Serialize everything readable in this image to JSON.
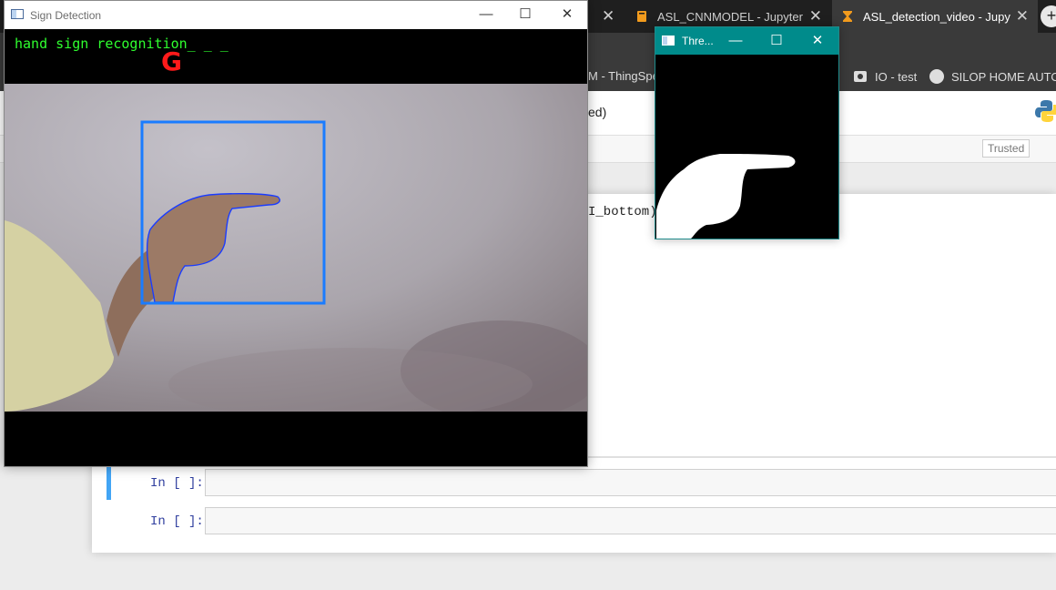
{
  "browser": {
    "tabs": [
      {
        "title": "ASL_CNNMODEL - Jupyter Not",
        "icon": "notebook-icon",
        "active": false
      },
      {
        "title": "ASL_detection_video - Jupyter",
        "icon": "hourglass-icon",
        "active": true
      }
    ],
    "tab_close_glyph": "✕",
    "newtab_glyph": "+",
    "bookmarks": [
      {
        "label": "M - ThingSpeak"
      },
      {
        "label": "IO - test"
      },
      {
        "label": "SILOP HOME AUTO..."
      }
    ]
  },
  "notebook": {
    "kernel_status": "ed)",
    "trusted_label": "Trusted",
    "code_fragment": "I_bottom),",
    "cells": [
      {
        "prompt": "In [ ]:",
        "selected": true
      },
      {
        "prompt": "In [ ]:",
        "selected": false
      }
    ]
  },
  "sign_window": {
    "title": "Sign Detection",
    "overlay_text": "hand sign recognition_ _ _",
    "predicted_letter": "G",
    "controls": {
      "minimize": "—",
      "maximize": "☐",
      "close": "✕"
    }
  },
  "threshold_window": {
    "title": "Thre...",
    "controls": {
      "minimize": "—",
      "maximize": "☐",
      "close": "✕"
    }
  },
  "colors": {
    "overlay_text": "#2fff2f",
    "predicted_letter": "#ff1a1a",
    "roi_box": "#1a7cff",
    "threshold_titlebar": "#008b8b",
    "cell_selected_bar": "#42a5f5"
  }
}
